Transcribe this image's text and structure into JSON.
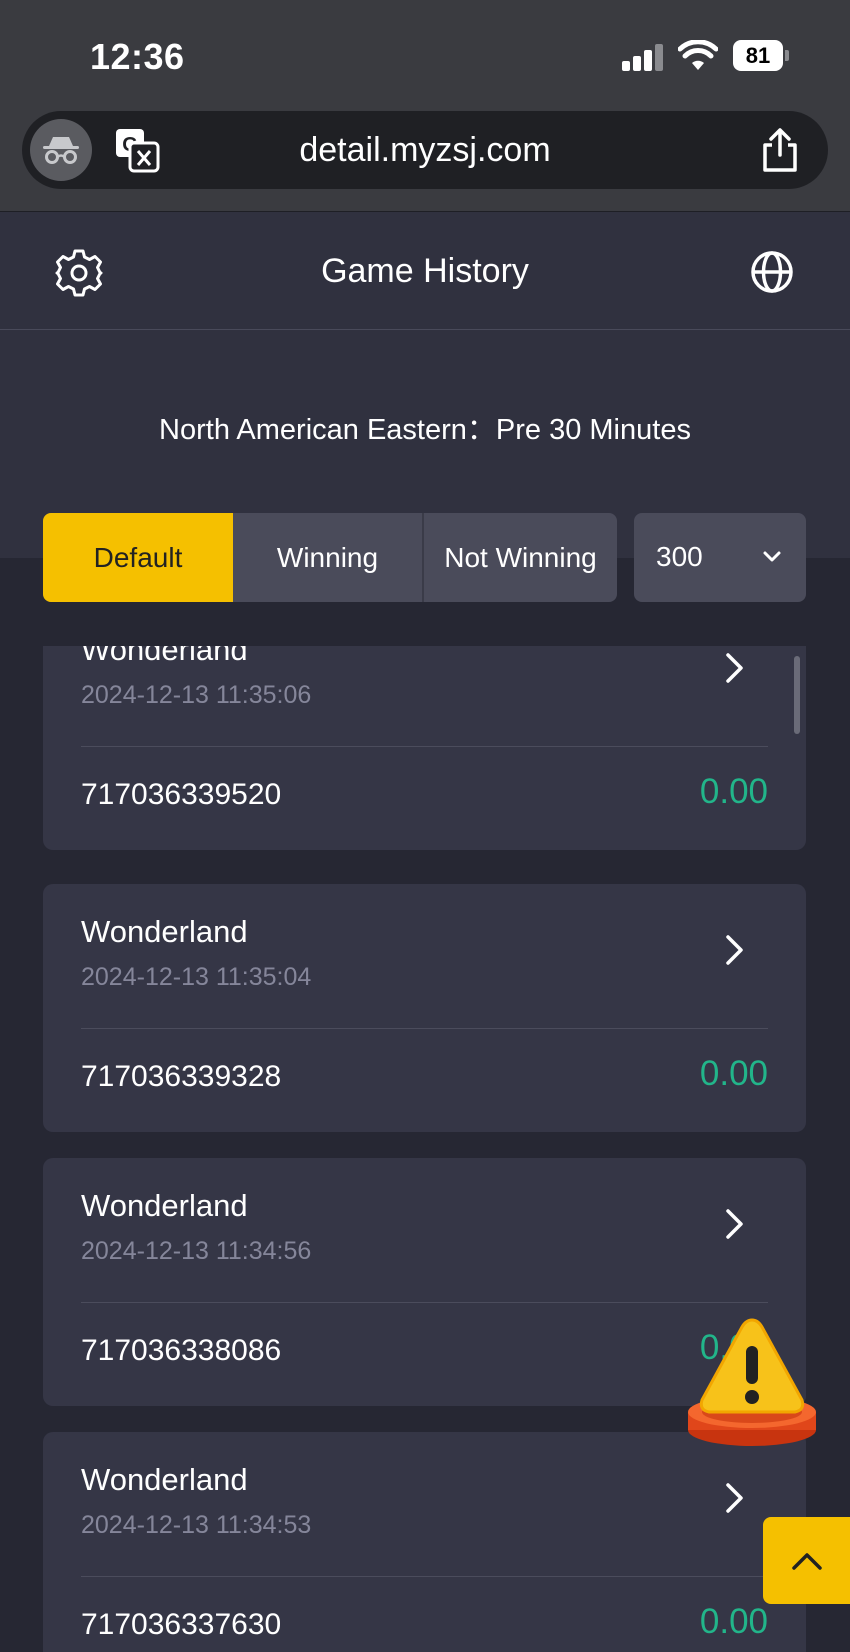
{
  "status_bar": {
    "time": "12:36",
    "battery": "81"
  },
  "browser": {
    "url": "detail.myzsj.com"
  },
  "header": {
    "title": "Game History"
  },
  "timezone_text": "North American Eastern：Pre 30 Minutes",
  "filters": {
    "tabs": [
      {
        "label": "Default",
        "active": true
      },
      {
        "label": "Winning",
        "active": false
      },
      {
        "label": "Not Winning",
        "active": false
      }
    ],
    "count": "300"
  },
  "records": [
    {
      "name": "Wonderland",
      "time": "2024-12-13 11:35:06",
      "id": "717036339520",
      "amount": "0.00"
    },
    {
      "name": "Wonderland",
      "time": "2024-12-13 11:35:04",
      "id": "717036339328",
      "amount": "0.00"
    },
    {
      "name": "Wonderland",
      "time": "2024-12-13 11:34:56",
      "id": "717036338086",
      "amount": "0.00"
    },
    {
      "name": "Wonderland",
      "time": "2024-12-13 11:34:53",
      "id": "717036337630",
      "amount": "0.00"
    }
  ],
  "colors": {
    "accent": "#f5c000",
    "positive": "#22b58a",
    "card": "#353646",
    "background": "#262733"
  }
}
